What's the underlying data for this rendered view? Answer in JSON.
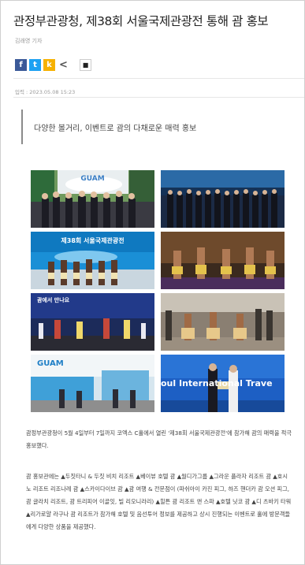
{
  "article": {
    "title": "관정부관광청, 제38회 서울국제관광전 통해 괌 홍보",
    "byline": "김래영 기자",
    "date": "입력 : 2023.05.08  15:23",
    "subtitle": "다양한 볼거리, 이벤트로 괌의 다채로운 매력 홍보",
    "paragraph1": "괌정부관광청이 5월 4일부터 7일까지 코엑스 C홀에서 열린 '제38회 서울국제관광전'에 참가해 괌의 매력을 적극 홍보했다.",
    "paragraph2": "괌 홍보관에는 ▲두짓타니 & 두짓 비치 리조트 ▲베이뷰 호텔 괌 ▲월디가그룹 ▲그라운 플라자 리조트 괌 ▲호시노 리조트 리조나레 괌 ▲스카이다이브 괌 ▲괌 여행 & 전문점이 (파쉬아이 카진 피그, 하즈 핸더카 괌 오션 피그, 괌 글라치 리조트, 괌 트리피어 이골잇, 빌 리오니라리) ▲힐튼 괌 리조트 앤 스파 ▲호텔 닛코 괌 ▲디 츠바키 타워 ▲리가로얄 라구나 괌 리조트가 참가해 호텔 및 음선투어 정보를 제공하고 상시 진행되는 이벤트로 홀에 방문객들에게 다양한 상품을 제공했다."
  },
  "share": {
    "facebook_label": "f",
    "twitter_label": "t",
    "kakaostory_label": "k",
    "share_label": "<",
    "bookmark_label": "■"
  },
  "photos": {
    "p1_caption": "GUAM",
    "p3_caption": "제38회 서울국제관광전",
    "p5_caption": "괌에서 만나요",
    "p7_caption": "GUAM",
    "p8_caption": "oul International Trave"
  },
  "colors": {
    "facebook": "#3b5998",
    "twitter": "#1da1f2",
    "kakaostory": "#f6b100",
    "booth_blue": "#1a8fd6"
  }
}
